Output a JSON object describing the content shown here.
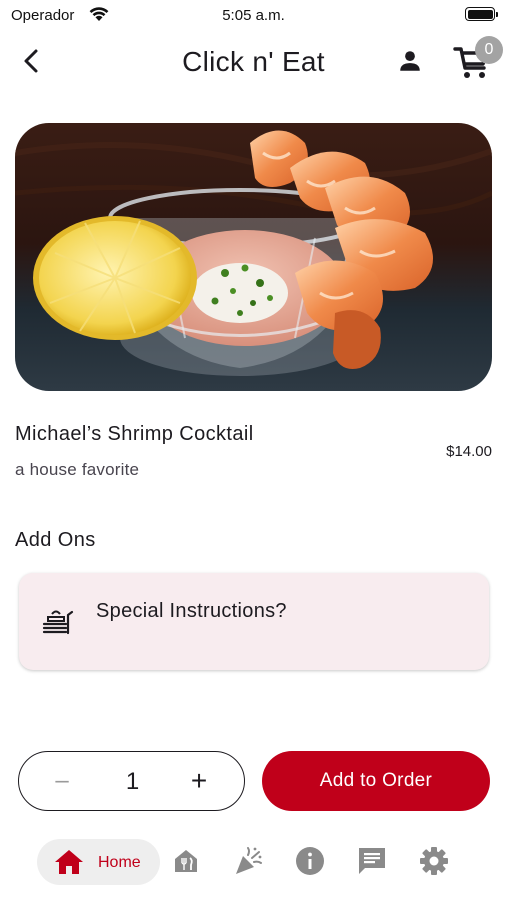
{
  "status_bar": {
    "carrier": "Operador",
    "time": "5:05 a.m."
  },
  "app_bar": {
    "title": "Click n' Eat",
    "cart_count": "0"
  },
  "item": {
    "name": "Michael’s Shrimp Cocktail",
    "description": "a house favorite",
    "price": "$14.00"
  },
  "add_ons": {
    "title": "Add Ons",
    "instructions_label": "Special Instructions?"
  },
  "order": {
    "quantity": "1",
    "minus_label": "–",
    "plus_label": "+",
    "add_label": "Add to Order"
  },
  "nav": {
    "home_label": "Home",
    "items": [
      "home-icon",
      "restaurant-icon",
      "party-icon",
      "info-icon",
      "chat-icon",
      "settings-icon"
    ]
  },
  "colors": {
    "accent": "#c0001a",
    "card_bg": "#f8ecef",
    "nav_active_bg": "#eeeeee",
    "icon_gray": "#8a8a8a"
  }
}
